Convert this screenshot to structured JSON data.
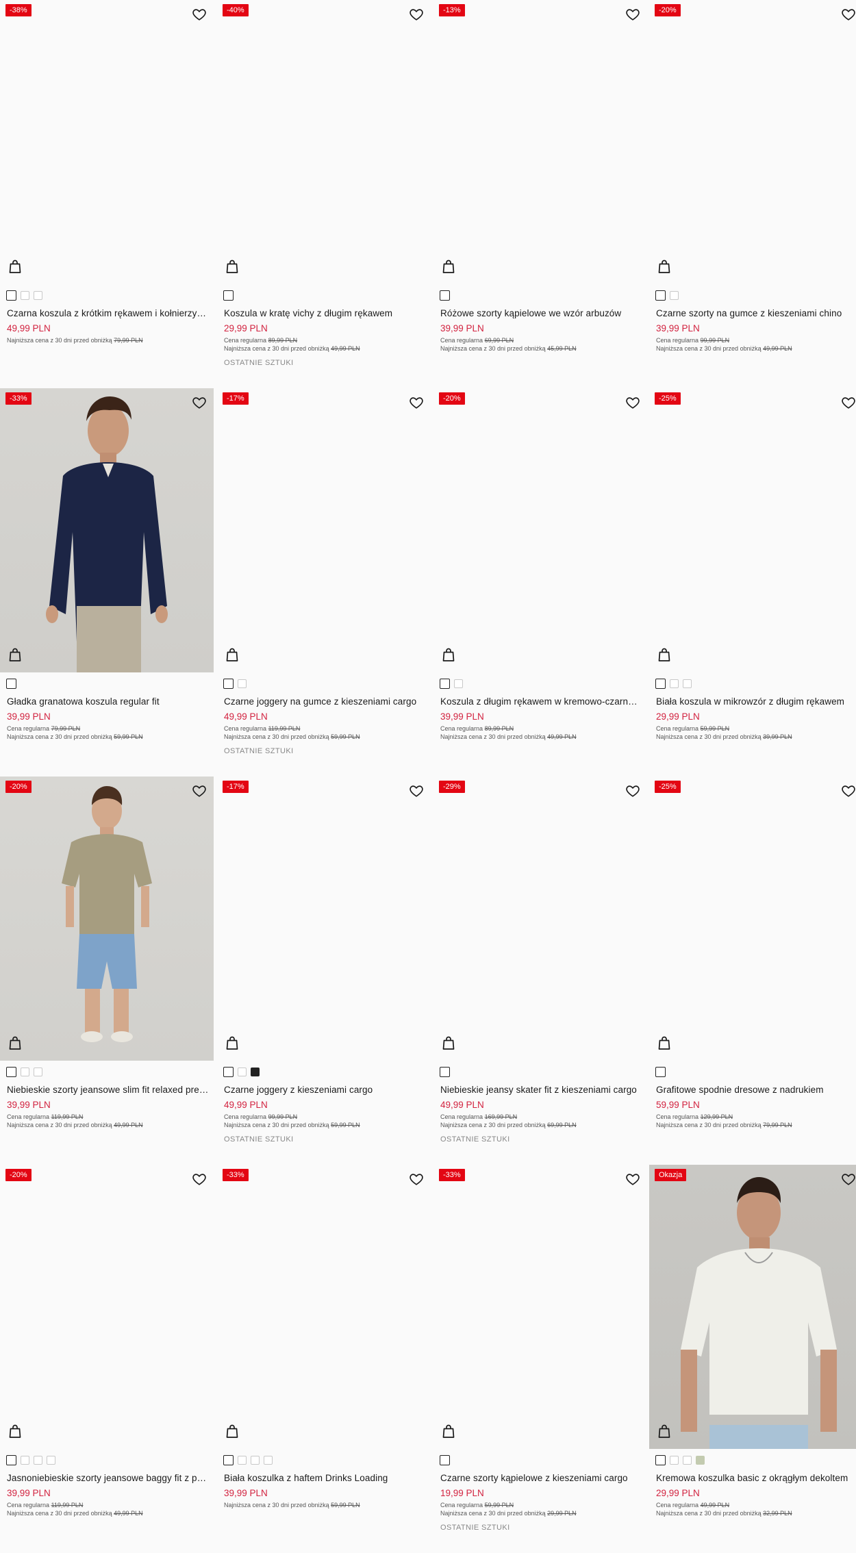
{
  "labels": {
    "regular": "Cena regularna",
    "lowest": "Najniższa cena z 30 dni przed obniżką",
    "last_items": "OSTATNIE SZTUKI"
  },
  "colors": {
    "badge": "#e30613",
    "price": "#d2223f"
  },
  "products": [
    {
      "badge": "-38%",
      "name": "Czarna koszula z krótkim rękawem i kołnierzykiem",
      "price": "49,99 PLN",
      "regular": "",
      "lowest": "79,99 PLN",
      "last": "",
      "swatches": [
        "sel",
        "w",
        "w"
      ]
    },
    {
      "badge": "-40%",
      "name": "Koszula w kratę vichy z długim rękawem",
      "price": "29,99 PLN",
      "regular": "89,99 PLN",
      "lowest": "49,99 PLN",
      "last": "OSTATNIE SZTUKI",
      "swatches": [
        "sel"
      ]
    },
    {
      "badge": "-13%",
      "name": "Różowe szorty kąpielowe we wzór arbuzów",
      "price": "39,99 PLN",
      "regular": "69,99 PLN",
      "lowest": "45,99 PLN",
      "last": "",
      "swatches": [
        "sel"
      ]
    },
    {
      "badge": "-20%",
      "name": "Czarne szorty na gumce z kieszeniami chino",
      "price": "39,99 PLN",
      "regular": "99,99 PLN",
      "lowest": "49,99 PLN",
      "last": "",
      "swatches": [
        "sel",
        "w"
      ]
    },
    {
      "badge": "-33%",
      "name": "Gładka granatowa koszula regular fit",
      "price": "39,99 PLN",
      "regular": "79,99 PLN",
      "lowest": "59,99 PLN",
      "last": "",
      "swatches": [
        "sel"
      ]
    },
    {
      "badge": "-17%",
      "name": "Czarne joggery na gumce z kieszeniami cargo",
      "price": "49,99 PLN",
      "regular": "119,99 PLN",
      "lowest": "59,99 PLN",
      "last": "OSTATNIE SZTUKI",
      "swatches": [
        "sel",
        "w"
      ]
    },
    {
      "badge": "-20%",
      "name": "Koszula z długim rękawem w kremowo-czarną kratę",
      "price": "39,99 PLN",
      "regular": "89,99 PLN",
      "lowest": "49,99 PLN",
      "last": "",
      "swatches": [
        "sel",
        "w"
      ]
    },
    {
      "badge": "-25%",
      "name": "Biała koszula w mikrowzór z długim rękawem",
      "price": "29,99 PLN",
      "regular": "59,99 PLN",
      "lowest": "39,99 PLN",
      "last": "",
      "swatches": [
        "sel",
        "w",
        "w"
      ]
    },
    {
      "badge": "-20%",
      "name": "Niebieskie szorty jeansowe slim fit relaxed premium",
      "price": "39,99 PLN",
      "regular": "119,99 PLN",
      "lowest": "49,99 PLN",
      "last": "",
      "swatches": [
        "sel",
        "w",
        "w"
      ]
    },
    {
      "badge": "-17%",
      "name": "Czarne joggery z kieszeniami cargo",
      "price": "49,99 PLN",
      "regular": "99,99 PLN",
      "lowest": "59,99 PLN",
      "last": "OSTATNIE SZTUKI",
      "swatches": [
        "sel",
        "w",
        "black"
      ]
    },
    {
      "badge": "-29%",
      "name": "Niebieskie jeansy skater fit z kieszeniami cargo",
      "price": "49,99 PLN",
      "regular": "169,99 PLN",
      "lowest": "69,99 PLN",
      "last": "OSTATNIE SZTUKI",
      "swatches": [
        "sel"
      ]
    },
    {
      "badge": "-25%",
      "name": "Grafitowe spodnie dresowe z nadrukiem",
      "price": "59,99 PLN",
      "regular": "129,99 PLN",
      "lowest": "79,99 PLN",
      "last": "",
      "swatches": [
        "sel"
      ]
    },
    {
      "badge": "-20%",
      "name": "Jasnoniebieskie szorty jeansowe baggy fit z przetarciami",
      "price": "39,99 PLN",
      "regular": "119,99 PLN",
      "lowest": "49,99 PLN",
      "last": "",
      "swatches": [
        "sel",
        "w",
        "w",
        "w"
      ]
    },
    {
      "badge": "-33%",
      "name": "Biała koszulka z haftem Drinks Loading",
      "price": "39,99 PLN",
      "regular": "",
      "lowest": "59,99 PLN",
      "last": "",
      "swatches": [
        "sel",
        "w",
        "w",
        "w"
      ]
    },
    {
      "badge": "-33%",
      "name": "Czarne szorty kąpielowe z kieszeniami cargo",
      "price": "19,99 PLN",
      "regular": "59,99 PLN",
      "lowest": "29,99 PLN",
      "last": "OSTATNIE SZTUKI",
      "swatches": [
        "sel"
      ]
    },
    {
      "badge": "Okazja",
      "name": "Kremowa koszulka basic z okrągłym dekoltem",
      "price": "29,99 PLN",
      "regular": "49,99 PLN",
      "lowest": "32,99 PLN",
      "last": "",
      "swatches": [
        "sel",
        "w",
        "w",
        "sage"
      ]
    }
  ]
}
